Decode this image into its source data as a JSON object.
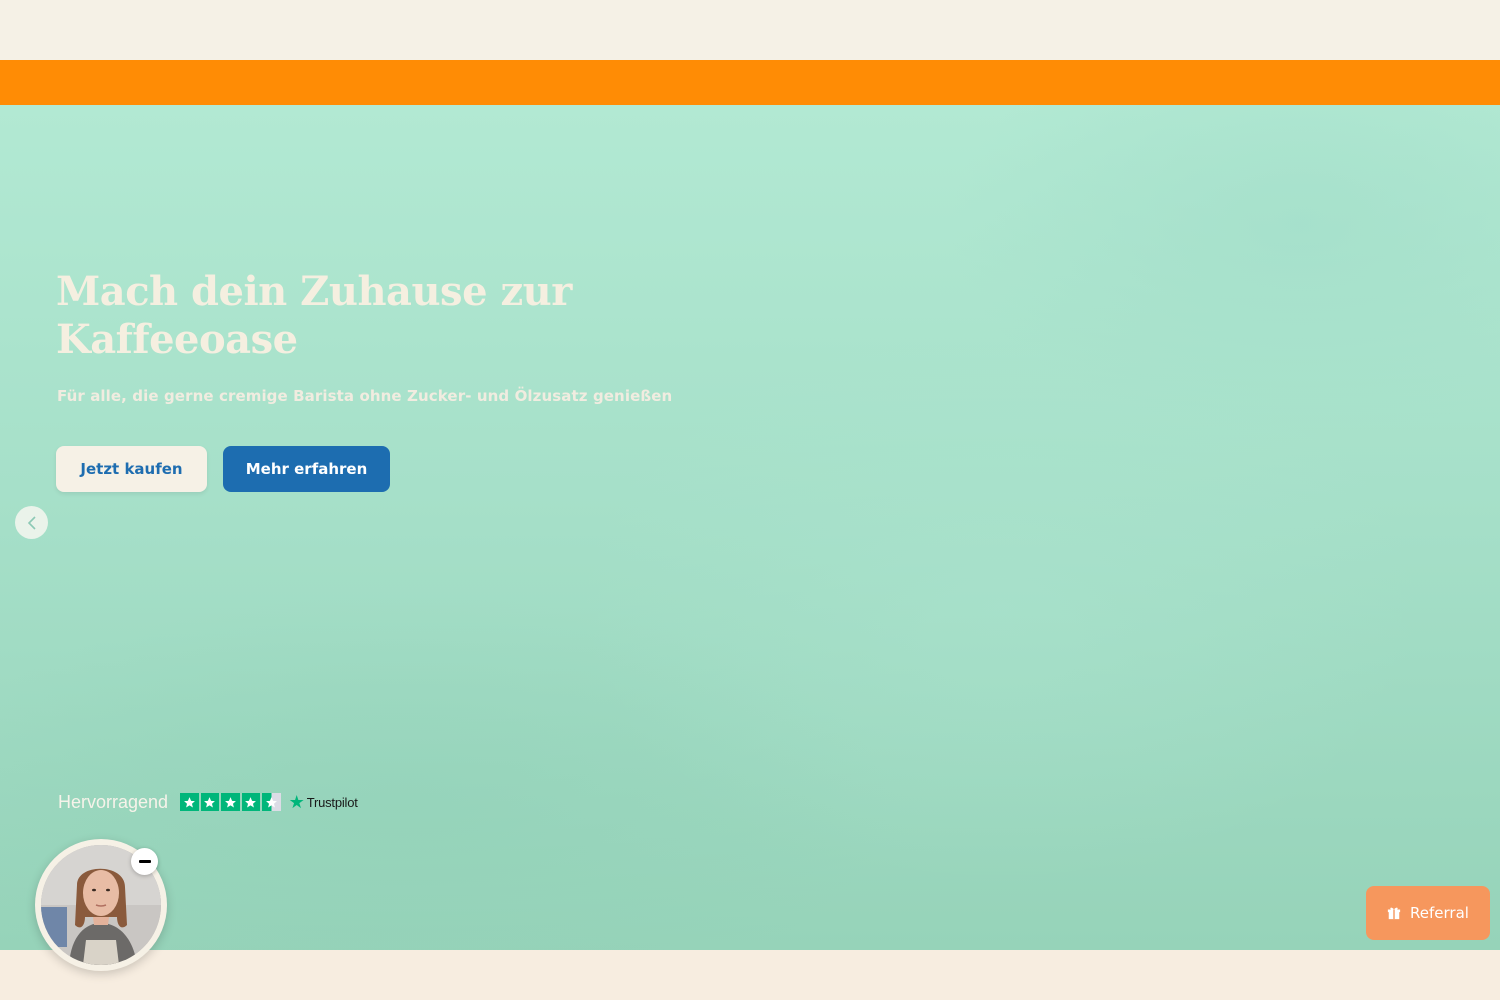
{
  "hero": {
    "title": "Mach dein Zuhause zur Kaffeeoase",
    "subtitle": "Für alle, die gerne cremige Barista ohne Zucker- und Ölzusatz genießen",
    "primary_button": "Jetzt kaufen",
    "secondary_button": "Mehr erfahren",
    "prev_arrow_icon": "chevron-left-icon"
  },
  "trustpilot": {
    "rating_text": "Hervorragend",
    "stars": 4.5,
    "brand": "Trustpilot"
  },
  "video_widget": {
    "minimize_icon": "minus-icon"
  },
  "referral": {
    "label": "Referral",
    "icon": "gift-icon"
  },
  "colors": {
    "announcement_bar": "#ff8c05",
    "hero_background": "#a8e2cb",
    "primary_blue": "#1d6db0",
    "cream": "#f6f1e6",
    "trustpilot_green": "#00b67a",
    "referral_orange": "#f6975d"
  }
}
